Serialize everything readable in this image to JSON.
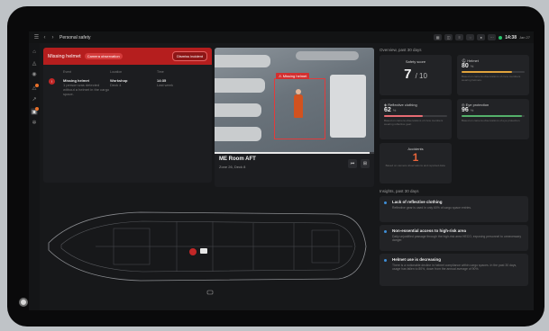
{
  "topbar": {
    "title": "Personal safety",
    "time": "14:38",
    "date": "Jan 27",
    "icons": [
      "menu-icon",
      "back-icon",
      "forward-icon"
    ]
  },
  "sidebar": {
    "icons": [
      "home-icon",
      "alert-icon",
      "location-icon",
      "warning-icon",
      "chart-icon",
      "camera-icon",
      "settings-icon"
    ]
  },
  "incident": {
    "title": "Missing helmet",
    "tag": "Camera observation",
    "dismiss": "Dismiss incident",
    "columns": [
      "Event",
      "Location",
      "Time"
    ],
    "row": {
      "event": "Missing helmet",
      "event_sub": "1 person was detected without a helmet in the cargo space.",
      "location": "Workshop",
      "location_sub": "Deck 4",
      "time": "14:35",
      "time_sub": "Last week"
    }
  },
  "camera": {
    "detection_label": "Missing helmet",
    "name": "ME Room AFT",
    "zone": "Zone 26, Deck 8",
    "progress": 0.97
  },
  "overview": {
    "label": "Overview, past 30 days",
    "safety_score": {
      "title": "Safety score",
      "value": "7",
      "max": "/ 10"
    },
    "helmet": {
      "title": "Helmet",
      "value": "80",
      "unit": "%",
      "sub": "Based on camera observations of crew members wearing helmets.",
      "fill": 0.8,
      "color": "#e0a33c"
    },
    "reflective": {
      "title": "Reflective clothing",
      "value": "62",
      "unit": "%",
      "sub": "Based on camera observations of crew members wearing reflective gear.",
      "fill": 0.62,
      "color": "#e76b73"
    },
    "eye": {
      "title": "Eye protection",
      "value": "96",
      "unit": "%",
      "sub": "Based on camera observations of eye protection.",
      "fill": 0.96,
      "color": "#54b06a"
    },
    "accidents": {
      "title": "Accidents",
      "value": "1",
      "sub": "Based on camera observations and reported data."
    }
  },
  "insights": {
    "label": "Insights, past 30 days",
    "items": [
      {
        "title": "Lack of reflective clothing",
        "body": "Reflective gear is used in only 60% of cargo space entries."
      },
      {
        "title": "Non-essential access to high-risk area",
        "body": "Daily unjustified passage through the high-risk area HECO, exposing personnel to unnecessary danger."
      },
      {
        "title": "Helmet use is decreasing",
        "body": "There is a noticeable decline in helmet compliance within cargo spaces. In the past 30 days, usage has fallen to 80%, down from the annual average of 90%."
      }
    ]
  }
}
